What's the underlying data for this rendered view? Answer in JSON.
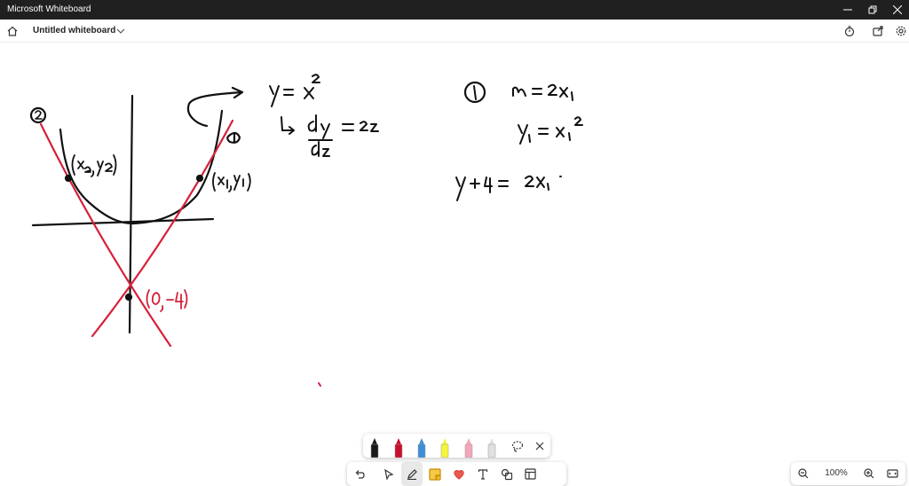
{
  "window": {
    "app_title": "Microsoft Whiteboard"
  },
  "header": {
    "board_title": "Untitled whiteboard"
  },
  "ink": {
    "color_black": "#111111",
    "color_red": "#d6203a"
  },
  "pen_toolbar": {
    "pens": [
      {
        "name": "black-pen",
        "color": "#1a1a1a"
      },
      {
        "name": "red-pen",
        "color": "#c8102e"
      },
      {
        "name": "blue-pen",
        "color": "#3a8fd6"
      },
      {
        "name": "yellow-highlighter",
        "color": "#f5f53a"
      },
      {
        "name": "pink-highlighter",
        "color": "#f4a7b9"
      },
      {
        "name": "eraser",
        "color": "#e0e0e0"
      }
    ]
  },
  "tool_toolbar": {
    "tools": [
      "undo-icon",
      "select-icon",
      "pen-icon",
      "sticky-note-icon",
      "reactions-icon",
      "text-icon",
      "shapes-icon",
      "templates-icon"
    ]
  },
  "zoom": {
    "level": "100%"
  }
}
